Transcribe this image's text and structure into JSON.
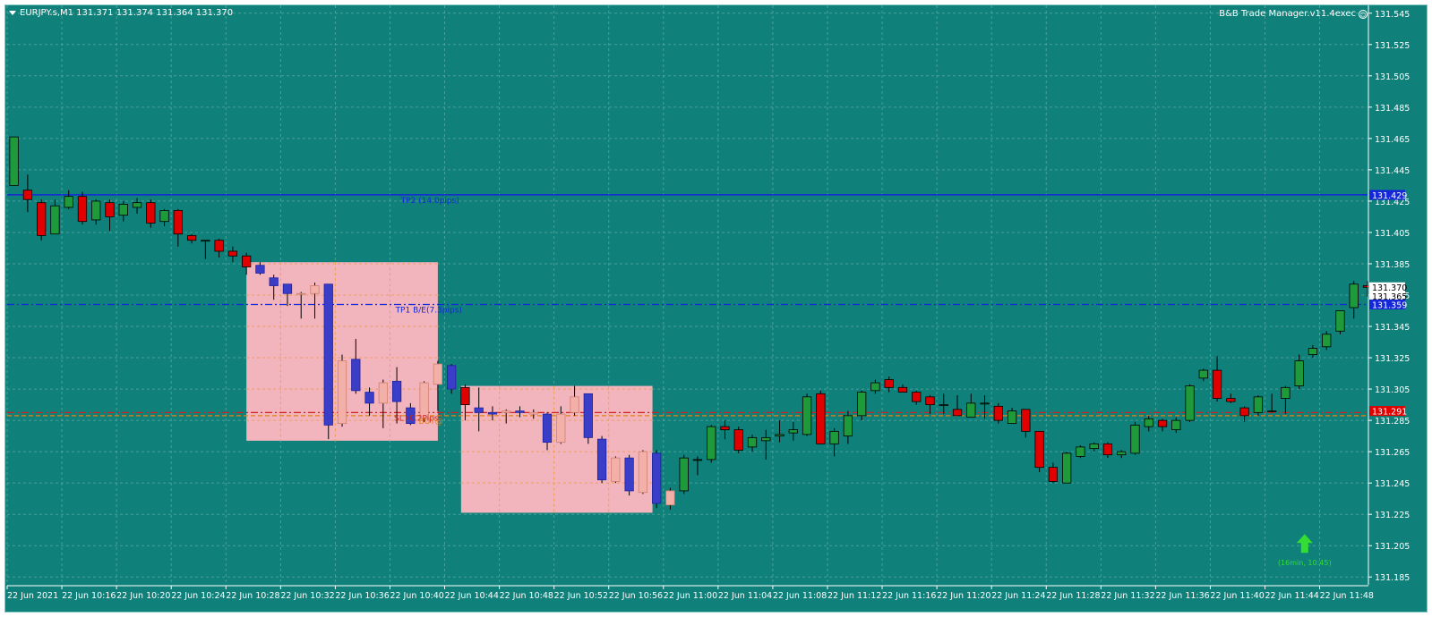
{
  "header": {
    "symbol_line": "EURJPY.s,M1  131.371 131.374 131.364 131.370",
    "ea_name": "B&B Trade Manager.v11.4exec"
  },
  "icons": {
    "menu": "chevron-down-icon",
    "smiley": "smiley-icon",
    "arrow": "up-arrow-icon"
  },
  "colors": {
    "background": "#0f807a",
    "bull": "#1f9a3a",
    "bear": "#e00000",
    "zone_candle_bull": "#f3b0a8",
    "zone_candle_bear": "#3a3dc8",
    "zone": "#ffb6c1",
    "tp_line": "#1428d8",
    "sl_line": "#e05010"
  },
  "axis": {
    "y_ticks": [
      "131.545",
      "131.525",
      "131.505",
      "131.485",
      "131.465",
      "131.445",
      "131.425",
      "131.405",
      "131.385",
      "131.365",
      "131.345",
      "131.325",
      "131.305",
      "131.285",
      "131.265",
      "131.245",
      "131.225",
      "131.205",
      "131.185"
    ],
    "x_ticks": [
      "22 Jun 2021",
      "22 Jun 10:16",
      "22 Jun 10:20",
      "22 Jun 10:24",
      "22 Jun 10:28",
      "22 Jun 10:32",
      "22 Jun 10:36",
      "22 Jun 10:40",
      "22 Jun 10:44",
      "22 Jun 10:48",
      "22 Jun 10:52",
      "22 Jun 10:56",
      "22 Jun 11:00",
      "22 Jun 11:04",
      "22 Jun 11:08",
      "22 Jun 11:12",
      "22 Jun 11:16",
      "22 Jun 11:20",
      "22 Jun 11:24",
      "22 Jun 11:28",
      "22 Jun 11:32",
      "22 Jun 11:36",
      "22 Jun 11:40",
      "22 Jun 11:44",
      "22 Jun 11:48"
    ]
  },
  "price_tags": [
    {
      "text": "131.429",
      "price": 131.429,
      "bg": "#1428d8",
      "fg": "#ffffff"
    },
    {
      "text": "131.370",
      "price": 131.37,
      "bg": "#ffffff",
      "fg": "#000000"
    },
    {
      "text": "131.365",
      "price": 131.3645,
      "bg": "#ffffff",
      "fg": "#000000"
    },
    {
      "text": "131.359",
      "price": 131.359,
      "bg": "#1428d8",
      "fg": "#ffffff"
    },
    {
      "text": "131.291",
      "price": 131.291,
      "bg": "#e00000",
      "fg": "#ffffff"
    }
  ],
  "levels": [
    {
      "label": "TP2 (14.0pips)",
      "price": 131.429,
      "style": "solid",
      "color": "#1428d8",
      "label_time": 28.8
    },
    {
      "label": "TP1 B/E(7.3pips)",
      "price": 131.359,
      "style": "dashdot",
      "color": "#1428d8",
      "label_time": 28.4
    },
    {
      "label": "SL (0.2Pips)",
      "price": 131.29,
      "style": "dashdot",
      "color": "#d02020",
      "label_time": 28.3
    },
    {
      "label": "BUY@",
      "price": 131.288,
      "style": "dashed",
      "color": "#e08020",
      "label_time": 30.1
    }
  ],
  "zones": [
    {
      "t1": 17.5,
      "t2": 31.5,
      "high": 131.386,
      "low": 131.272
    },
    {
      "t1": 33.2,
      "t2": 47.2,
      "high": 131.307,
      "low": 131.226
    }
  ],
  "signal": {
    "label": "(16min, 10:45)",
    "time": 94.9,
    "price": 131.205
  },
  "chart_data": {
    "type": "candlestick",
    "symbol": "EURJPY.s",
    "timeframe": "M1",
    "ylim": [
      131.18,
      131.55
    ],
    "time_range": [
      0,
      99.5
    ],
    "x_tick_time": [
      0,
      4,
      8,
      12,
      16,
      20,
      24,
      28,
      32,
      36,
      40,
      44,
      48,
      52,
      56,
      60,
      64,
      68,
      72,
      76,
      80,
      84,
      88,
      92,
      96
    ],
    "candles": [
      {
        "o": 131.435,
        "h": 131.466,
        "l": 131.435,
        "c": 131.466,
        "z": 0
      },
      {
        "o": 131.432,
        "h": 131.442,
        "l": 131.418,
        "c": 131.426,
        "z": 0
      },
      {
        "o": 131.424,
        "h": 131.426,
        "l": 131.4,
        "c": 131.403,
        "z": 0
      },
      {
        "o": 131.404,
        "h": 131.426,
        "l": 131.404,
        "c": 131.422,
        "z": 0
      },
      {
        "o": 131.421,
        "h": 131.432,
        "l": 131.42,
        "c": 131.428,
        "z": 0
      },
      {
        "o": 131.428,
        "h": 131.431,
        "l": 131.41,
        "c": 131.412,
        "z": 0
      },
      {
        "o": 131.413,
        "h": 131.426,
        "l": 131.41,
        "c": 131.425,
        "z": 0
      },
      {
        "o": 131.424,
        "h": 131.426,
        "l": 131.406,
        "c": 131.415,
        "z": 0
      },
      {
        "o": 131.416,
        "h": 131.425,
        "l": 131.412,
        "c": 131.423,
        "z": 0
      },
      {
        "o": 131.421,
        "h": 131.427,
        "l": 131.417,
        "c": 131.424,
        "z": 0
      },
      {
        "o": 131.424,
        "h": 131.426,
        "l": 131.408,
        "c": 131.411,
        "z": 0
      },
      {
        "o": 131.412,
        "h": 131.42,
        "l": 131.409,
        "c": 131.419,
        "z": 0
      },
      {
        "o": 131.419,
        "h": 131.42,
        "l": 131.396,
        "c": 131.404,
        "z": 0
      },
      {
        "o": 131.403,
        "h": 131.404,
        "l": 131.398,
        "c": 131.4,
        "z": 0
      },
      {
        "o": 131.4,
        "h": 131.4,
        "l": 131.388,
        "c": 131.4,
        "z": 0
      },
      {
        "o": 131.4,
        "h": 131.401,
        "l": 131.389,
        "c": 131.393,
        "z": 0
      },
      {
        "o": 131.393,
        "h": 131.396,
        "l": 131.386,
        "c": 131.39,
        "z": 0
      },
      {
        "o": 131.39,
        "h": 131.392,
        "l": 131.378,
        "c": 131.383,
        "z": 0
      },
      {
        "o": 131.384,
        "h": 131.386,
        "l": 131.378,
        "c": 131.379,
        "z": 1
      },
      {
        "o": 131.376,
        "h": 131.378,
        "l": 131.362,
        "c": 131.371,
        "z": 1
      },
      {
        "o": 131.372,
        "h": 131.372,
        "l": 131.358,
        "c": 131.366,
        "z": 1
      },
      {
        "o": 131.366,
        "h": 131.367,
        "l": 131.35,
        "c": 131.366,
        "z": 1
      },
      {
        "o": 131.366,
        "h": 131.373,
        "l": 131.35,
        "c": 131.371,
        "z": 1
      },
      {
        "o": 131.372,
        "h": 131.372,
        "l": 131.273,
        "c": 131.282,
        "z": 1
      },
      {
        "o": 131.283,
        "h": 131.327,
        "l": 131.281,
        "c": 131.323,
        "z": 1
      },
      {
        "o": 131.324,
        "h": 131.337,
        "l": 131.302,
        "c": 131.304,
        "z": 1
      },
      {
        "o": 131.303,
        "h": 131.306,
        "l": 131.288,
        "c": 131.296,
        "z": 1
      },
      {
        "o": 131.296,
        "h": 131.311,
        "l": 131.28,
        "c": 131.309,
        "z": 1
      },
      {
        "o": 131.31,
        "h": 131.319,
        "l": 131.283,
        "c": 131.297,
        "z": 1
      },
      {
        "o": 131.293,
        "h": 131.296,
        "l": 131.282,
        "c": 131.283,
        "z": 1
      },
      {
        "o": 131.286,
        "h": 131.31,
        "l": 131.284,
        "c": 131.309,
        "z": 1
      },
      {
        "o": 131.308,
        "h": 131.323,
        "l": 131.291,
        "c": 131.321,
        "z": 1
      },
      {
        "o": 131.32,
        "h": 131.321,
        "l": 131.302,
        "c": 131.305,
        "z": 1
      },
      {
        "o": 131.306,
        "h": 131.308,
        "l": 131.285,
        "c": 131.295,
        "z": 0
      },
      {
        "o": 131.293,
        "h": 131.306,
        "l": 131.278,
        "c": 131.29,
        "z": 2
      },
      {
        "o": 131.29,
        "h": 131.294,
        "l": 131.285,
        "c": 131.289,
        "z": 2
      },
      {
        "o": 131.29,
        "h": 131.292,
        "l": 131.283,
        "c": 131.291,
        "z": 2
      },
      {
        "o": 131.291,
        "h": 131.294,
        "l": 131.287,
        "c": 131.29,
        "z": 2
      },
      {
        "o": 131.289,
        "h": 131.292,
        "l": 131.286,
        "c": 131.29,
        "z": 2
      },
      {
        "o": 131.289,
        "h": 131.29,
        "l": 131.266,
        "c": 131.271,
        "z": 2
      },
      {
        "o": 131.271,
        "h": 131.294,
        "l": 131.27,
        "c": 131.289,
        "z": 2
      },
      {
        "o": 131.29,
        "h": 131.307,
        "l": 131.288,
        "c": 131.3,
        "z": 2
      },
      {
        "o": 131.302,
        "h": 131.302,
        "l": 131.27,
        "c": 131.274,
        "z": 2
      },
      {
        "o": 131.273,
        "h": 131.275,
        "l": 131.245,
        "c": 131.247,
        "z": 2
      },
      {
        "o": 131.246,
        "h": 131.262,
        "l": 131.245,
        "c": 131.261,
        "z": 2
      },
      {
        "o": 131.261,
        "h": 131.263,
        "l": 131.237,
        "c": 131.24,
        "z": 2
      },
      {
        "o": 131.239,
        "h": 131.266,
        "l": 131.238,
        "c": 131.265,
        "z": 2
      },
      {
        "o": 131.264,
        "h": 131.266,
        "l": 131.229,
        "c": 131.232,
        "z": 2
      },
      {
        "o": 131.231,
        "h": 131.242,
        "l": 131.228,
        "c": 131.24,
        "z": 2
      },
      {
        "o": 131.24,
        "h": 131.263,
        "l": 131.238,
        "c": 131.261,
        "z": 0
      },
      {
        "o": 131.26,
        "h": 131.262,
        "l": 131.25,
        "c": 131.26,
        "z": 0
      },
      {
        "o": 131.26,
        "h": 131.282,
        "l": 131.258,
        "c": 131.281,
        "z": 0
      },
      {
        "o": 131.281,
        "h": 131.285,
        "l": 131.273,
        "c": 131.279,
        "z": 0
      },
      {
        "o": 131.279,
        "h": 131.281,
        "l": 131.264,
        "c": 131.266,
        "z": 0
      },
      {
        "o": 131.268,
        "h": 131.276,
        "l": 131.265,
        "c": 131.274,
        "z": 0
      },
      {
        "o": 131.272,
        "h": 131.279,
        "l": 131.26,
        "c": 131.274,
        "z": 0
      },
      {
        "o": 131.275,
        "h": 131.285,
        "l": 131.271,
        "c": 131.276,
        "z": 0
      },
      {
        "o": 131.277,
        "h": 131.284,
        "l": 131.272,
        "c": 131.279,
        "z": 0
      },
      {
        "o": 131.276,
        "h": 131.302,
        "l": 131.275,
        "c": 131.3,
        "z": 0
      },
      {
        "o": 131.302,
        "h": 131.304,
        "l": 131.273,
        "c": 131.27,
        "z": 0
      },
      {
        "o": 131.27,
        "h": 131.28,
        "l": 131.262,
        "c": 131.278,
        "z": 0
      },
      {
        "o": 131.275,
        "h": 131.291,
        "l": 131.27,
        "c": 131.288,
        "z": 0
      },
      {
        "o": 131.288,
        "h": 131.304,
        "l": 131.285,
        "c": 131.303,
        "z": 0
      },
      {
        "o": 131.304,
        "h": 131.311,
        "l": 131.302,
        "c": 131.309,
        "z": 0
      },
      {
        "o": 131.311,
        "h": 131.313,
        "l": 131.303,
        "c": 131.306,
        "z": 0
      },
      {
        "o": 131.306,
        "h": 131.308,
        "l": 131.303,
        "c": 131.303,
        "z": 0
      },
      {
        "o": 131.303,
        "h": 131.304,
        "l": 131.295,
        "c": 131.297,
        "z": 0
      },
      {
        "o": 131.3,
        "h": 131.301,
        "l": 131.289,
        "c": 131.295,
        "z": 0
      },
      {
        "o": 131.295,
        "h": 131.302,
        "l": 131.289,
        "c": 131.295,
        "z": 0
      },
      {
        "o": 131.292,
        "h": 131.301,
        "l": 131.289,
        "c": 131.288,
        "z": 0
      },
      {
        "o": 131.287,
        "h": 131.302,
        "l": 131.287,
        "c": 131.296,
        "z": 0
      },
      {
        "o": 131.296,
        "h": 131.301,
        "l": 131.286,
        "c": 131.296,
        "z": 0
      },
      {
        "o": 131.294,
        "h": 131.296,
        "l": 131.283,
        "c": 131.285,
        "z": 0
      },
      {
        "o": 131.283,
        "h": 131.293,
        "l": 131.283,
        "c": 131.291,
        "z": 0
      },
      {
        "o": 131.292,
        "h": 131.292,
        "l": 131.274,
        "c": 131.278,
        "z": 0
      },
      {
        "o": 131.278,
        "h": 131.278,
        "l": 131.252,
        "c": 131.255,
        "z": 0
      },
      {
        "o": 131.255,
        "h": 131.258,
        "l": 131.245,
        "c": 131.246,
        "z": 0
      },
      {
        "o": 131.245,
        "h": 131.265,
        "l": 131.245,
        "c": 131.264,
        "z": 0
      },
      {
        "o": 131.262,
        "h": 131.269,
        "l": 131.261,
        "c": 131.268,
        "z": 0
      },
      {
        "o": 131.267,
        "h": 131.271,
        "l": 131.265,
        "c": 131.27,
        "z": 0
      },
      {
        "o": 131.27,
        "h": 131.271,
        "l": 131.261,
        "c": 131.263,
        "z": 0
      },
      {
        "o": 131.263,
        "h": 131.266,
        "l": 131.261,
        "c": 131.265,
        "z": 0
      },
      {
        "o": 131.264,
        "h": 131.284,
        "l": 131.263,
        "c": 131.282,
        "z": 0
      },
      {
        "o": 131.281,
        "h": 131.288,
        "l": 131.278,
        "c": 131.286,
        "z": 0
      },
      {
        "o": 131.285,
        "h": 131.286,
        "l": 131.278,
        "c": 131.281,
        "z": 0
      },
      {
        "o": 131.279,
        "h": 131.287,
        "l": 131.277,
        "c": 131.285,
        "z": 0
      },
      {
        "o": 131.285,
        "h": 131.308,
        "l": 131.284,
        "c": 131.307,
        "z": 0
      },
      {
        "o": 131.312,
        "h": 131.318,
        "l": 131.31,
        "c": 131.317,
        "z": 0
      },
      {
        "o": 131.317,
        "h": 131.326,
        "l": 131.297,
        "c": 131.299,
        "z": 0
      },
      {
        "o": 131.299,
        "h": 131.302,
        "l": 131.296,
        "c": 131.297,
        "z": 0
      },
      {
        "o": 131.293,
        "h": 131.294,
        "l": 131.284,
        "c": 131.288,
        "z": 0
      },
      {
        "o": 131.29,
        "h": 131.301,
        "l": 131.288,
        "c": 131.3,
        "z": 0
      },
      {
        "o": 131.291,
        "h": 131.302,
        "l": 131.29,
        "c": 131.291,
        "z": 0
      },
      {
        "o": 131.299,
        "h": 131.307,
        "l": 131.289,
        "c": 131.306,
        "z": 0
      },
      {
        "o": 131.307,
        "h": 131.327,
        "l": 131.305,
        "c": 131.323,
        "z": 0
      },
      {
        "o": 131.327,
        "h": 131.333,
        "l": 131.325,
        "c": 131.331,
        "z": 0
      },
      {
        "o": 131.332,
        "h": 131.342,
        "l": 131.33,
        "c": 131.34,
        "z": 0
      },
      {
        "o": 131.342,
        "h": 131.355,
        "l": 131.34,
        "c": 131.355,
        "z": 0
      },
      {
        "o": 131.357,
        "h": 131.374,
        "l": 131.35,
        "c": 131.372,
        "z": 0
      },
      {
        "o": 131.371,
        "h": 131.374,
        "l": 131.364,
        "c": 131.37,
        "z": 0
      }
    ]
  }
}
